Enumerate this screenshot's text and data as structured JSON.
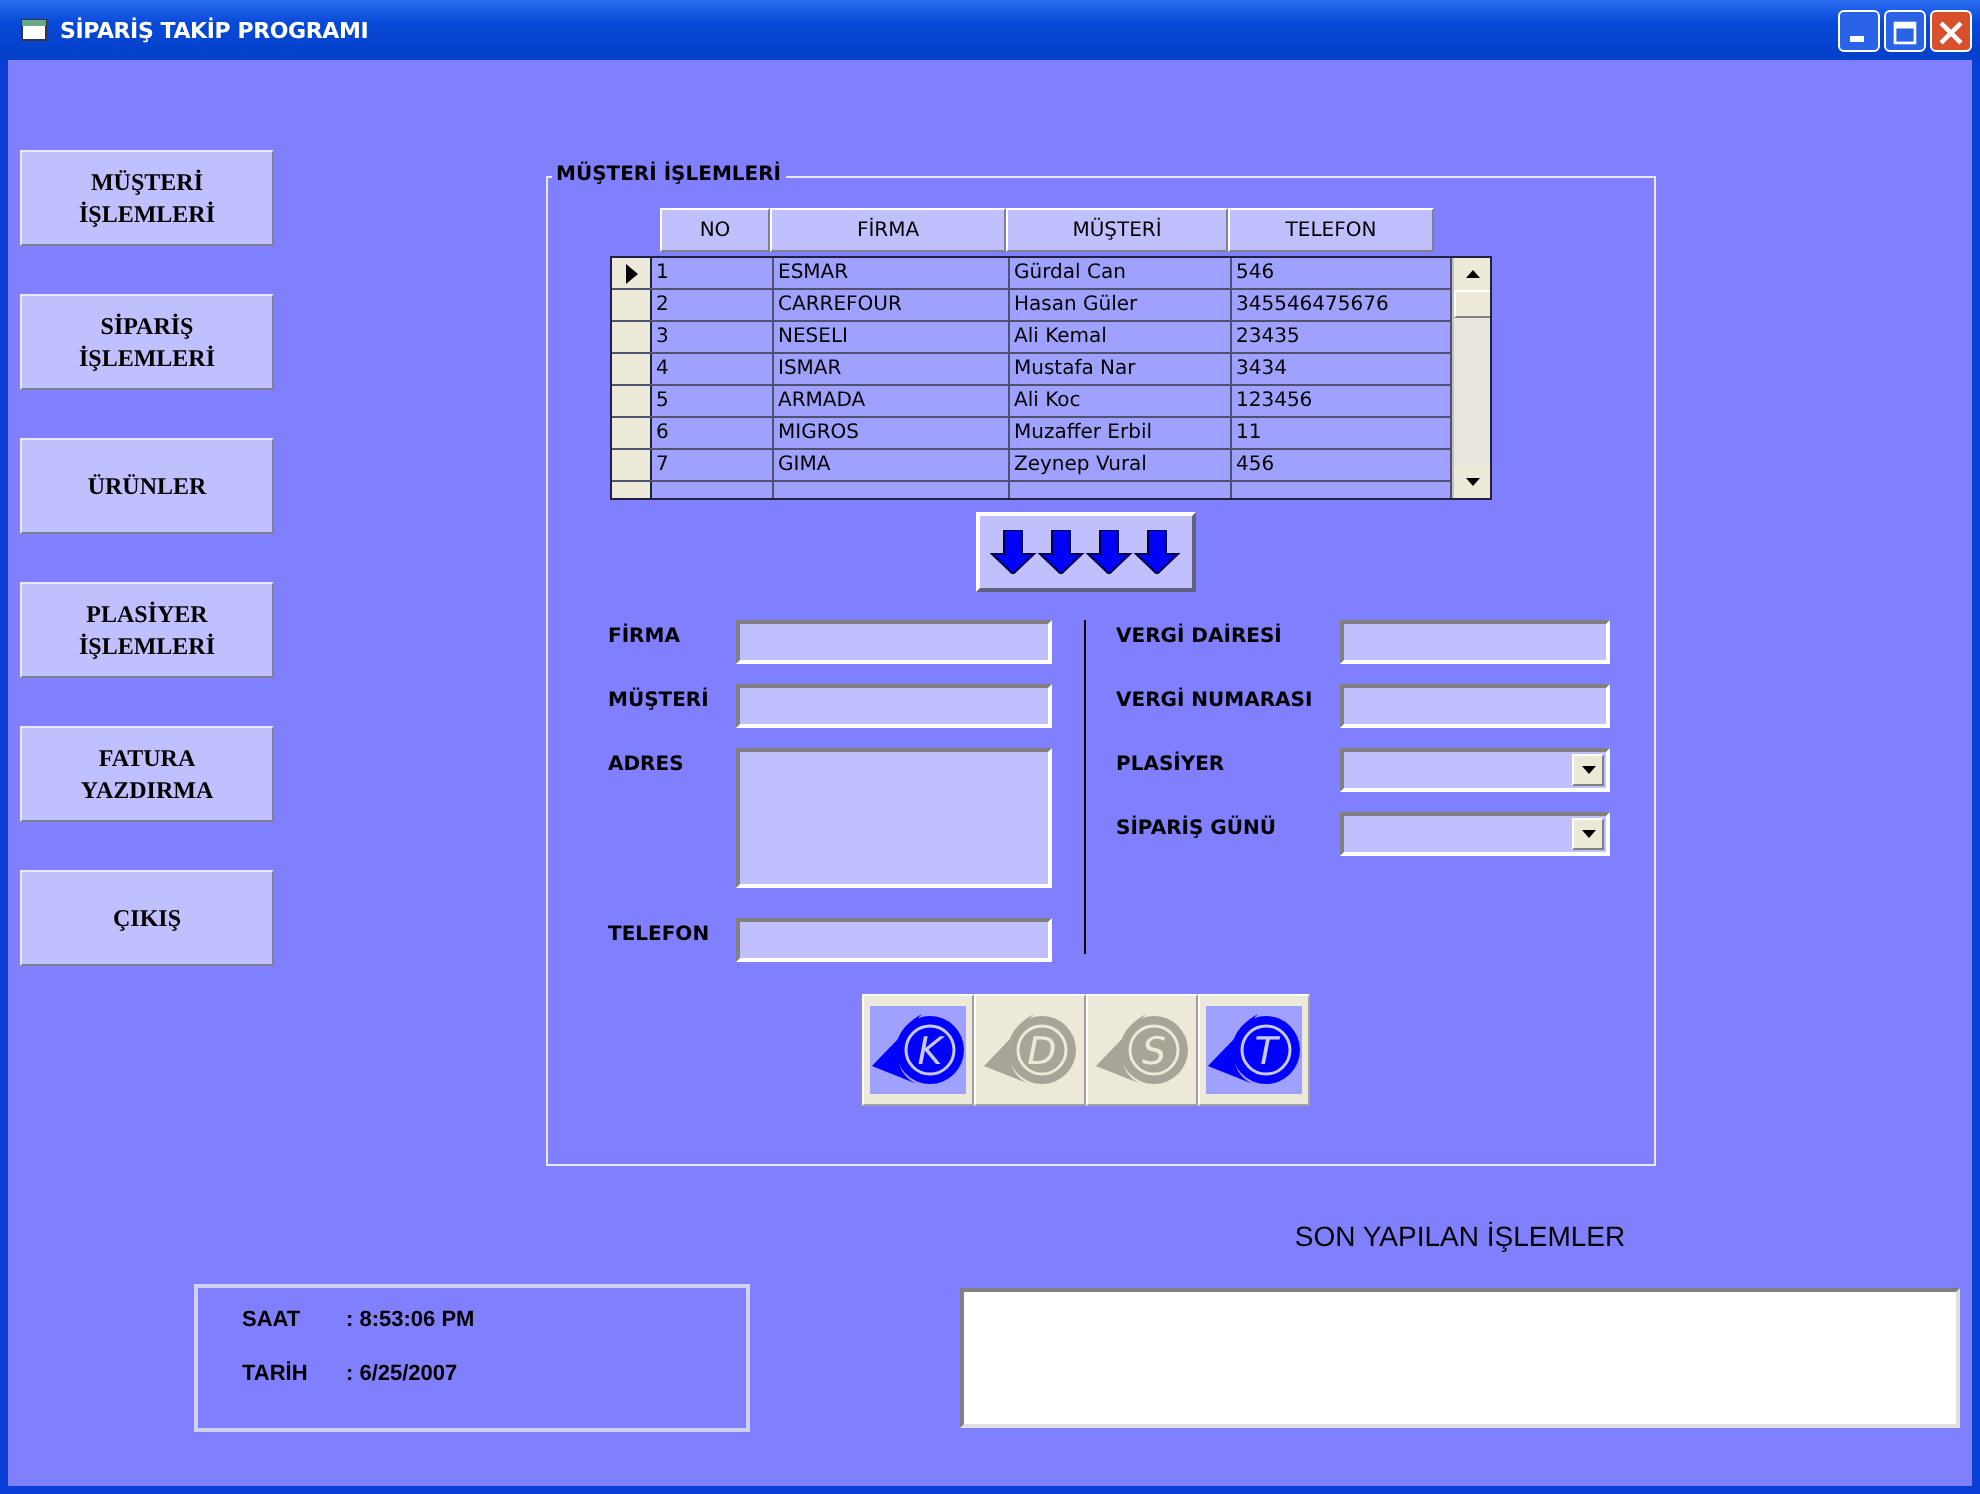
{
  "window": {
    "title": "SİPARİŞ TAKİP PROGRAMI"
  },
  "menu_buttons": [
    "MÜŞTERİ İŞLEMLERİ",
    "SİPARİŞ İŞLEMLERİ",
    "ÜRÜNLER",
    "PLASİYER İŞLEMLERİ",
    "FATURA YAZDIRMA",
    "ÇIKIŞ"
  ],
  "group": {
    "title": "MÜŞTERİ İŞLEMLERİ",
    "table": {
      "columns": [
        "NO",
        "FİRMA",
        "MÜŞTERİ",
        "TELEFON"
      ],
      "rows": [
        {
          "no": "1",
          "firma": "ESMAR",
          "musteri": "Gürdal Can",
          "telefon": "546",
          "selected": true
        },
        {
          "no": "2",
          "firma": "CARREFOUR",
          "musteri": "Hasan Güler",
          "telefon": "345546475676",
          "selected": false
        },
        {
          "no": "3",
          "firma": "NESELI",
          "musteri": "Ali Kemal",
          "telefon": "23435",
          "selected": false
        },
        {
          "no": "4",
          "firma": "ISMAR",
          "musteri": "Mustafa Nar",
          "telefon": "3434",
          "selected": false
        },
        {
          "no": "5",
          "firma": "ARMADA",
          "musteri": "Ali Koc",
          "telefon": "123456",
          "selected": false
        },
        {
          "no": "6",
          "firma": "MIGROS",
          "musteri": "Muzaffer Erbil",
          "telefon": "11",
          "selected": false
        },
        {
          "no": "7",
          "firma": "GIMA",
          "musteri": "Zeynep Vural",
          "telefon": "456",
          "selected": false
        }
      ]
    },
    "left_fields": [
      {
        "label": "FİRMA",
        "kind": "text"
      },
      {
        "label": "MÜŞTERİ",
        "kind": "text"
      },
      {
        "label": "ADRES",
        "kind": "textarea"
      },
      {
        "label": "TELEFON",
        "kind": "text"
      }
    ],
    "right_fields": [
      {
        "label": "VERGİ DAİRESİ",
        "kind": "text"
      },
      {
        "label": "VERGİ NUMARASI",
        "kind": "text"
      },
      {
        "label": "PLASİYER",
        "kind": "combo"
      },
      {
        "label": "SİPARİŞ GÜNÜ",
        "kind": "combo"
      }
    ],
    "action_buttons": [
      {
        "label": "K",
        "disabled": false
      },
      {
        "label": "D",
        "disabled": true
      },
      {
        "label": "S",
        "disabled": true
      },
      {
        "label": "T",
        "disabled": false
      }
    ]
  },
  "clock": [
    {
      "label": "SAAT",
      "value": ": 8:53:06 PM"
    },
    {
      "label": "TARİH",
      "value": ": 6/25/2007"
    }
  ],
  "recent_actions": {
    "title": "SON YAPILAN İŞLEMLER"
  }
}
